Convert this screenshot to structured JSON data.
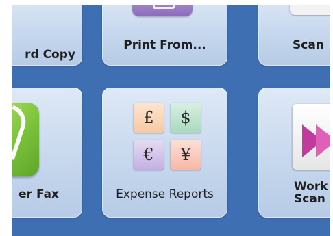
{
  "tiles": {
    "copy": {
      "label": "rd Copy"
    },
    "print": {
      "label": "Print From..."
    },
    "scan": {
      "label": "Scan"
    },
    "fax": {
      "label": "er Fax"
    },
    "expense": {
      "label": "Expense Reports",
      "symbols": {
        "pound": "£",
        "dollar": "$",
        "euro": "€",
        "yen": "¥"
      }
    },
    "work": {
      "label_line1": "Work",
      "label_line2": "Scan"
    }
  },
  "colors": {
    "background": "#3f6fb3",
    "tile": "#c7d8ee",
    "fax_green": "#7bc23a",
    "print_purple": "#8a6cbc",
    "work_magenta": "#c23a9b"
  },
  "icons": [
    "copy-icon",
    "print-from-icon",
    "scan-icon",
    "fax-phone-icon",
    "currency-grid-icon",
    "workflow-scan-icon"
  ]
}
